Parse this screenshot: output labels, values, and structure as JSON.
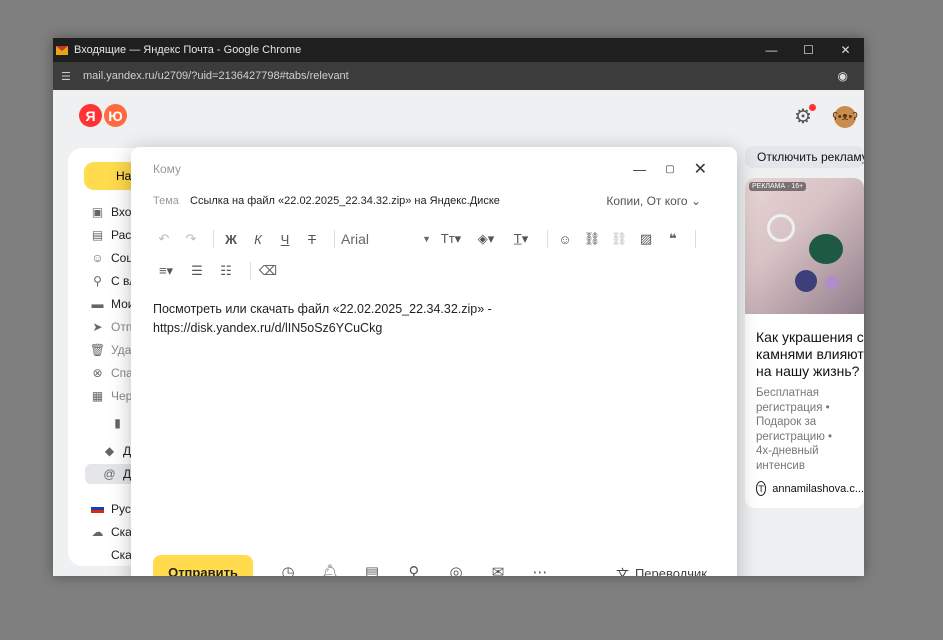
{
  "browser": {
    "title": "Входящие — Яндекс Почта - Google Chrome",
    "url": "mail.yandex.ru/u2709/?uid=2136427798#tabs/relevant"
  },
  "mail": {
    "logo_letters": [
      "Я",
      "Ю"
    ],
    "compose_label": "На",
    "nav": [
      {
        "label": "Вход",
        "icon": "inbox-icon",
        "glyph": "▣"
      },
      {
        "label": "Расс",
        "icon": "newsletter-icon",
        "glyph": "▤"
      },
      {
        "label": "Соц",
        "icon": "social-icon",
        "glyph": "☺"
      },
      {
        "label": "С вл",
        "icon": "attachment-icon",
        "glyph": "⚲"
      },
      {
        "label": "Мои",
        "icon": "folder-icon",
        "glyph": "▬"
      },
      {
        "label": "Отп",
        "icon": "sent-icon",
        "glyph": "➤"
      },
      {
        "label": "Уда",
        "icon": "trash-icon",
        "glyph": "🗑"
      },
      {
        "label": "Спа",
        "icon": "spam-icon",
        "glyph": "⊗"
      },
      {
        "label": "Чер",
        "icon": "drafts-icon",
        "glyph": "▦"
      }
    ],
    "labels": [
      {
        "label": "Д",
        "icon": "tag-icon",
        "glyph": "◆"
      },
      {
        "label": "Д",
        "icon": "at-icon",
        "glyph": "@"
      }
    ],
    "extras": [
      {
        "label": "Рус",
        "icon": "russian-flag-icon"
      },
      {
        "label": "Скач",
        "icon": "cloud-icon",
        "glyph": "☁"
      },
      {
        "label": "Скачать для iOS",
        "icon": "apple-icon",
        "glyph": ""
      }
    ]
  },
  "ads": {
    "disable_label": "Отключить рекламу",
    "badge": "РЕКЛАМА · 16+",
    "title": "Как украшения с камнями влияют на нашу жизнь?",
    "desc": [
      "Бесплатная регистрация •",
      "Подарок за регистрацию •",
      "4х-дневный интенсив"
    ],
    "site": "annamilashova.c..."
  },
  "compose": {
    "to_label": "Кому",
    "subject_label": "Тема",
    "subject": "Ссылка на файл «22.02.2025_22.34.32.zip» на Яндекс.Диске",
    "cc_label": "Копии, От кого",
    "font": "Arial",
    "body_line1": "Посмотреть или скачать файл «22.02.2025_22.34.32.zip» -",
    "body_line2": "https://disk.yandex.ru/d/lIN5oSz6YCuCkg",
    "send_label": "Отправить",
    "translator_label": "Переводчик"
  }
}
